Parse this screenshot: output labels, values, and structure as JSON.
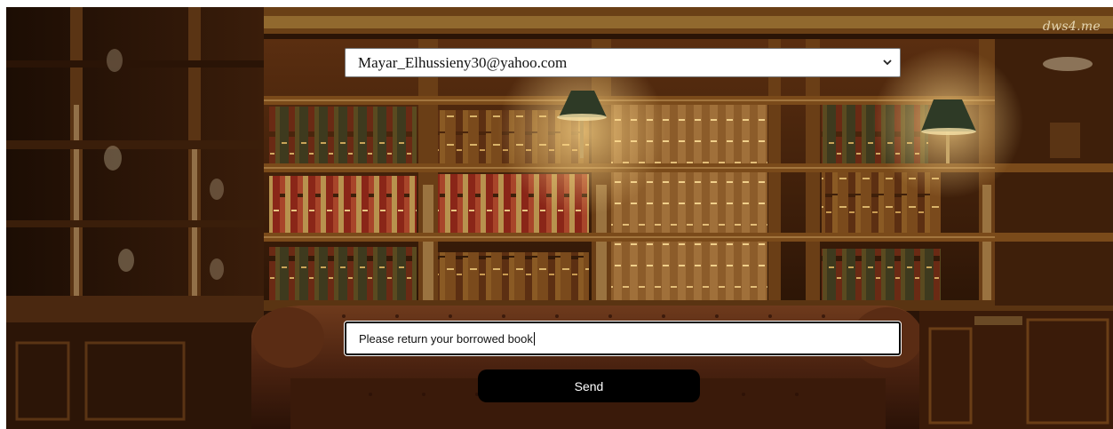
{
  "watermark": {
    "text": "dws4.me"
  },
  "form": {
    "recipient": {
      "selected": "Mayar_Elhussieny30@yahoo.com",
      "icon": "chevron-down-icon"
    },
    "message": {
      "value": "Please return your borrowed book"
    },
    "send_label": "Send"
  },
  "colors": {
    "wood_dark": "#2a1408",
    "wood_mid": "#6b3a16",
    "lamp_glow": "#f6c46a",
    "button_bg": "#000000",
    "button_text": "#ffffff"
  }
}
